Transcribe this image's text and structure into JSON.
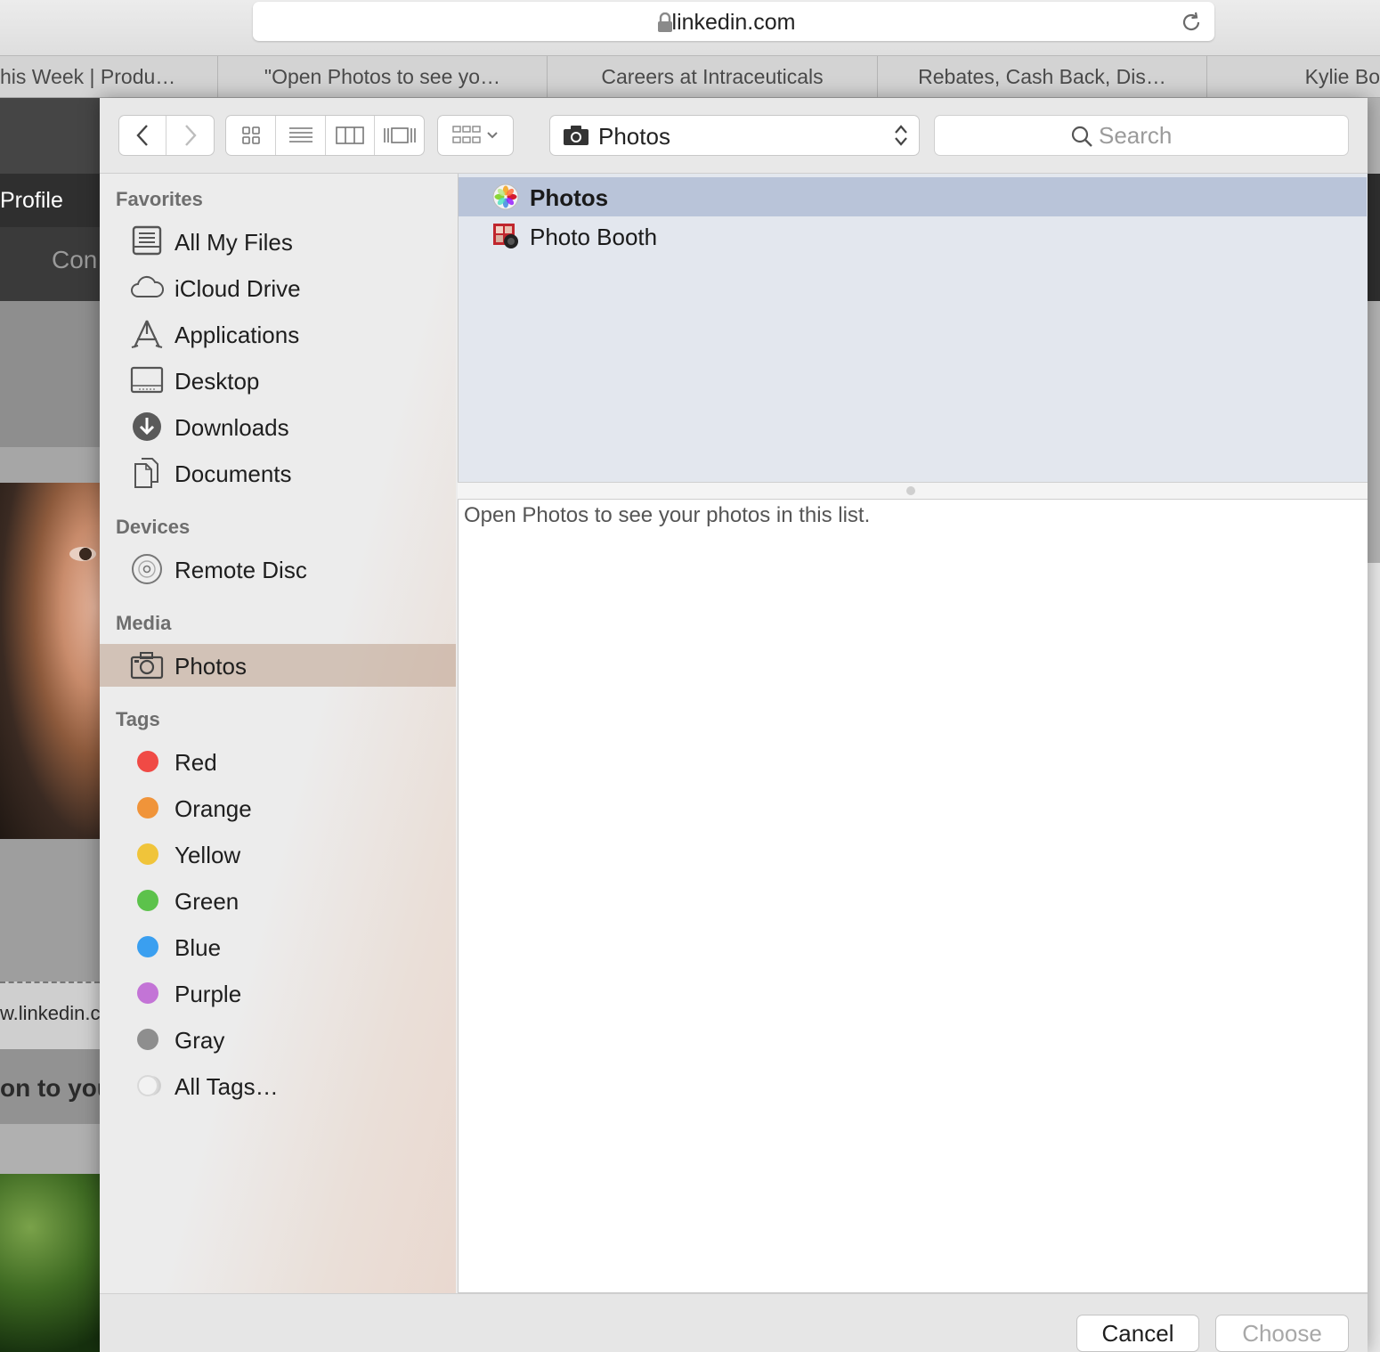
{
  "browser": {
    "address": "linkedin.com",
    "tabs": [
      "his Week | Produ…",
      "\"Open Photos to see yo…",
      "Careers at Intraceuticals",
      "Rebates, Cash Back, Dis…",
      "Kylie Bo"
    ]
  },
  "background_page": {
    "nav_profile": "Profile",
    "nav_second": "Con",
    "link_fragment": "w.linkedin.c",
    "bold_fragment": "on to you"
  },
  "dialog": {
    "location": "Photos",
    "search_placeholder": "Search",
    "sidebar": {
      "favorites_title": "Favorites",
      "favorites": [
        "All My Files",
        "iCloud Drive",
        "Applications",
        "Desktop",
        "Downloads",
        "Documents"
      ],
      "devices_title": "Devices",
      "devices": [
        "Remote Disc"
      ],
      "media_title": "Media",
      "media": [
        "Photos"
      ],
      "tags_title": "Tags",
      "tags": [
        {
          "label": "Red",
          "color": "#f04a45"
        },
        {
          "label": "Orange",
          "color": "#f0943a"
        },
        {
          "label": "Yellow",
          "color": "#f0c43a"
        },
        {
          "label": "Green",
          "color": "#5cc24b"
        },
        {
          "label": "Blue",
          "color": "#3a9ff0"
        },
        {
          "label": "Purple",
          "color": "#c374d6"
        },
        {
          "label": "Gray",
          "color": "#8e8e8e"
        },
        {
          "label": "All Tags…",
          "color": "#d8d8d8"
        }
      ]
    },
    "list": [
      "Photos",
      "Photo Booth"
    ],
    "info_message": "Open Photos to see your photos in this list.",
    "buttons": {
      "cancel": "Cancel",
      "choose": "Choose"
    }
  },
  "colors": {
    "selection_list": "#b9c4d9",
    "disabled_text": "#a8a8a8"
  }
}
